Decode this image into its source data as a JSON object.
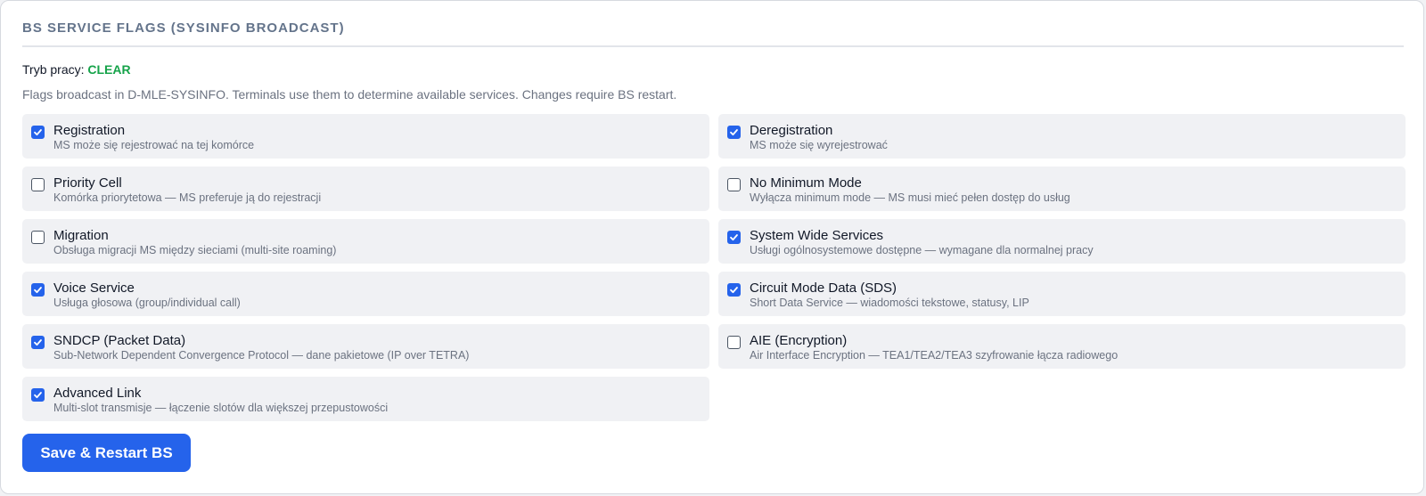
{
  "panel": {
    "title": "BS SERVICE FLAGS (SYSINFO BROADCAST)",
    "mode_label": "Tryb pracy:",
    "mode_value": "CLEAR",
    "description": "Flags broadcast in D-MLE-SYSINFO. Terminals use them to determine available services. Changes require BS restart."
  },
  "colors": {
    "accent": "#2563eb",
    "mode_value": "#16a34a",
    "item_background": "#f0f1f4"
  },
  "flags": [
    {
      "label": "Registration",
      "description": "MS może się rejestrować na tej komórce",
      "checked": true
    },
    {
      "label": "Deregistration",
      "description": "MS może się wyrejestrować",
      "checked": true
    },
    {
      "label": "Priority Cell",
      "description": "Komórka priorytetowa — MS preferuje ją do rejestracji",
      "checked": false
    },
    {
      "label": "No Minimum Mode",
      "description": "Wyłącza minimum mode — MS musi mieć pełen dostęp do usług",
      "checked": false
    },
    {
      "label": "Migration",
      "description": "Obsługa migracji MS między sieciami (multi-site roaming)",
      "checked": false
    },
    {
      "label": "System Wide Services",
      "description": "Usługi ogólnosystemowe dostępne — wymagane dla normalnej pracy",
      "checked": true
    },
    {
      "label": "Voice Service",
      "description": "Usługa głosowa (group/individual call)",
      "checked": true
    },
    {
      "label": "Circuit Mode Data (SDS)",
      "description": "Short Data Service — wiadomości tekstowe, statusy, LIP",
      "checked": true
    },
    {
      "label": "SNDCP (Packet Data)",
      "description": "Sub-Network Dependent Convergence Protocol — dane pakietowe (IP over TETRA)",
      "checked": true
    },
    {
      "label": "AIE (Encryption)",
      "description": "Air Interface Encryption — TEA1/TEA2/TEA3 szyfrowanie łącza radiowego",
      "checked": false
    },
    {
      "label": "Advanced Link",
      "description": "Multi-slot transmisje — łączenie slotów dla większej przepustowości",
      "checked": true
    }
  ],
  "actions": {
    "save_label": "Save & Restart BS"
  }
}
